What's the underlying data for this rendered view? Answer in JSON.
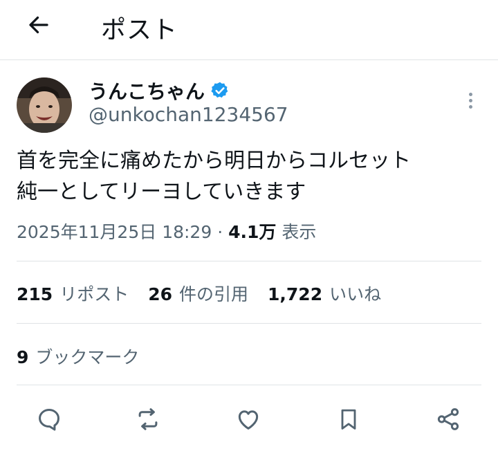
{
  "header": {
    "title": "ポスト",
    "back_icon": "arrow-left-icon"
  },
  "author": {
    "name": "うんこちゃん",
    "handle": "@unkochan1234567",
    "verified_color": "#1d9bf0"
  },
  "post": {
    "text": "首を完全に痛めたから明日からコルセット\n純一としてリーヨしていきます",
    "timestamp": "2025年11月25日 18:29",
    "separator": "·",
    "views_count": "4.1万",
    "views_label": "表示"
  },
  "stats": {
    "reposts_count": "215",
    "reposts_label": "リポスト",
    "quotes_count": "26",
    "quotes_label": "件の引用",
    "likes_count": "1,722",
    "likes_label": "いいね",
    "bookmarks_count": "9",
    "bookmarks_label": "ブックマーク"
  },
  "actions": [
    "reply-icon",
    "repost-icon",
    "like-icon",
    "bookmark-icon",
    "share-icon"
  ],
  "colors": {
    "text": "#0f1419",
    "secondary": "#536471",
    "divider": "#dfe3e6",
    "accent": "#1d9bf0"
  }
}
